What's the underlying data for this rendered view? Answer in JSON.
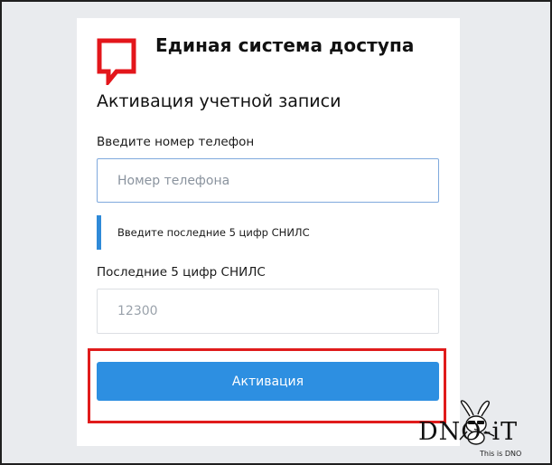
{
  "brand": {
    "title": "Единая система доступа",
    "logo_color": "#e3161b"
  },
  "page": {
    "title": "Активация учетной записи"
  },
  "form": {
    "phone": {
      "label": "Введите номер телефон",
      "placeholder": "Номер телефона",
      "value": ""
    },
    "hint": {
      "text": "Введите последние 5 цифр СНИЛС"
    },
    "snils": {
      "label": "Последние 5 цифр СНИЛС",
      "placeholder": "12300",
      "value": ""
    },
    "submit": {
      "label": "Активация",
      "color": "#2d8fe1"
    }
  },
  "annotation": {
    "highlight_color": "#e01b1b"
  },
  "watermark": {
    "text": "DNO-iT",
    "subtext": "This is DNO"
  }
}
